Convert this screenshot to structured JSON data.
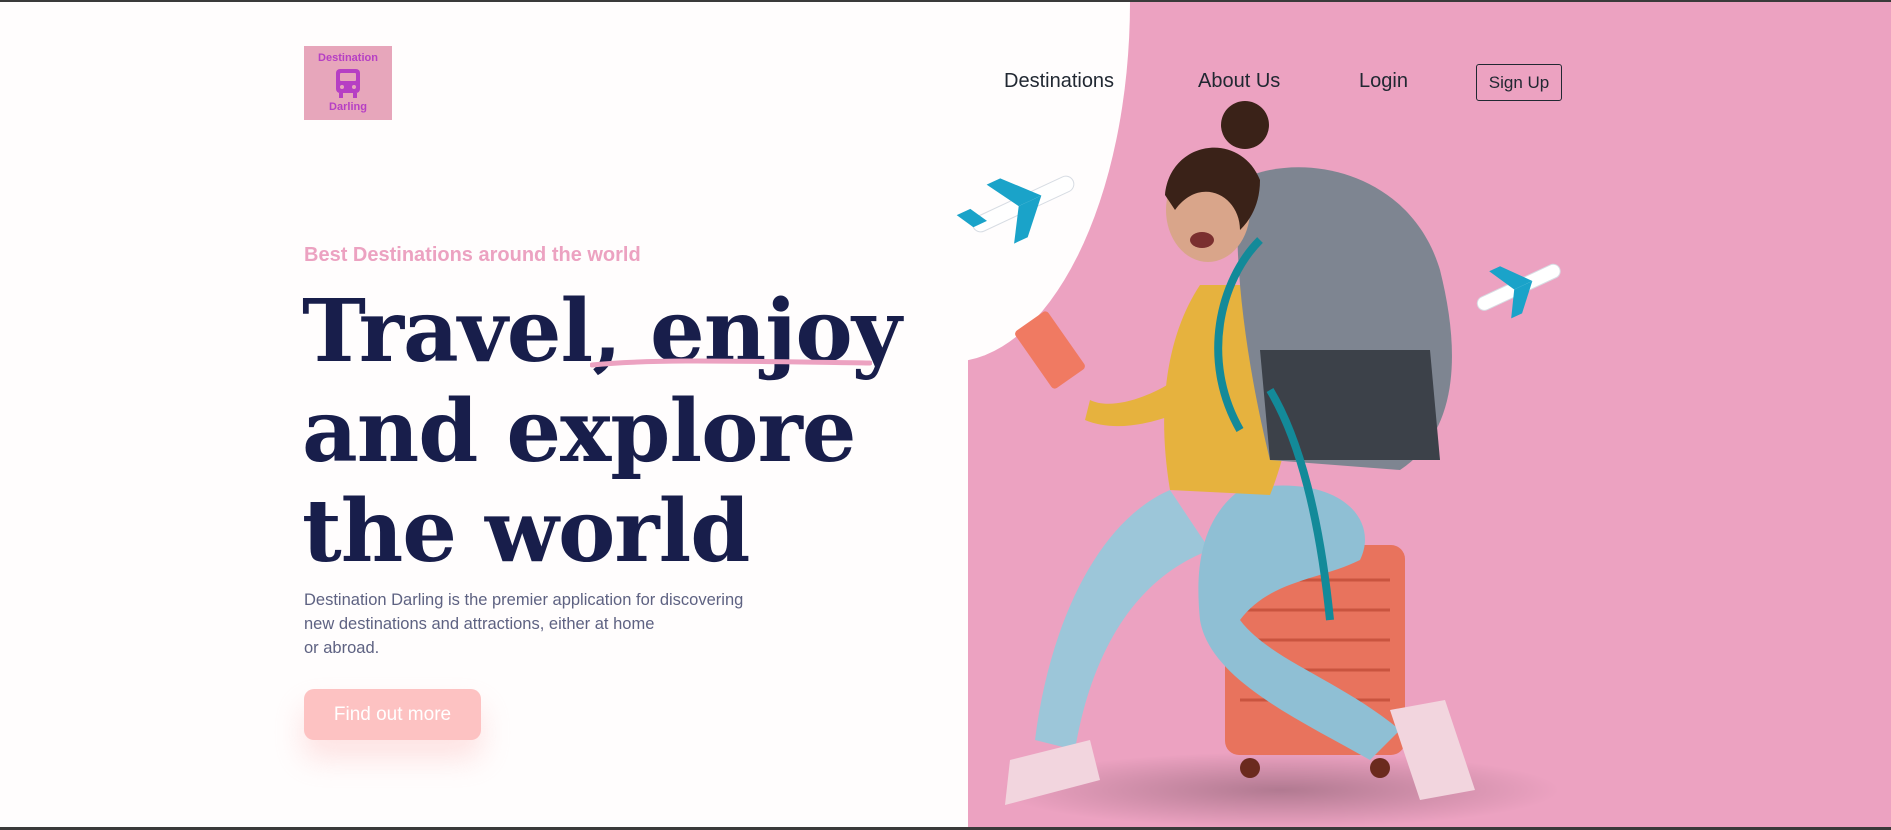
{
  "brand": {
    "logo_top": "Destination",
    "logo_bottom": "Darling"
  },
  "nav": {
    "destinations": "Destinations",
    "about": "About Us",
    "login": "Login",
    "signup": "Sign Up"
  },
  "hero": {
    "eyebrow": "Best Destinations around the world",
    "headline_lines": [
      "Travel, enjoy",
      "and explore",
      "the world"
    ],
    "description_lines": [
      "Destination Darling is the premier application for discovering",
      "new destinations and attractions, either at home",
      "or abroad."
    ],
    "cta": "Find out more"
  },
  "colors": {
    "accent_pink": "#eca2c1",
    "headline_navy": "#181e4b",
    "cta_pink": "#fdc2c2",
    "logo_bg": "#e7a6bb",
    "logo_fg": "#b63fc4"
  },
  "icons": [
    "bus-icon",
    "airplane-icon"
  ]
}
